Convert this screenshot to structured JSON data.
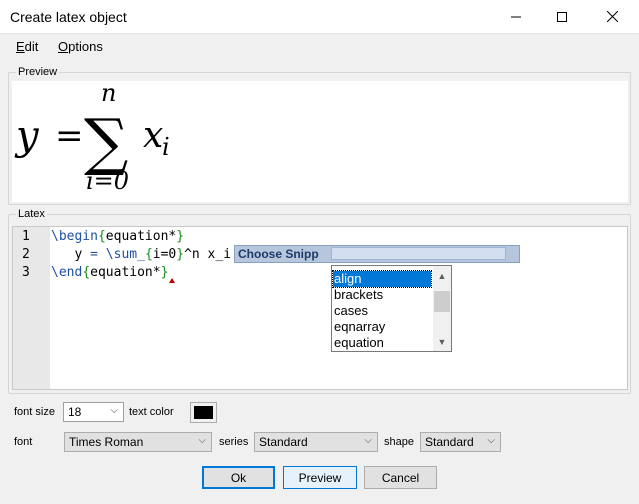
{
  "window": {
    "title": "Create latex object"
  },
  "menu": {
    "edit": "Edit",
    "options": "Options"
  },
  "preview": {
    "legend": "Preview",
    "formula": {
      "lhs": "y",
      "eq": "=",
      "sigma": "∑",
      "upper": "n",
      "lower": "i=0",
      "var": "x",
      "sub": "i"
    }
  },
  "latex": {
    "legend": "Latex",
    "line_numbers": [
      "1",
      "2",
      "3"
    ],
    "line1": {
      "cmd": "\\begin",
      "open": "{",
      "arg": "equation*",
      "close": "}"
    },
    "line2": {
      "indent": "   ",
      "y": "y",
      "eq": " = ",
      "sum": "\\sum_",
      "open": "{",
      "idx": "i=0",
      "close": "}",
      "rest": "^n x_i"
    },
    "line3": {
      "cmd": "\\end",
      "open": "{",
      "arg": "equation*",
      "close": "}"
    },
    "snippet": {
      "label": "Choose Snipp",
      "input_value": "",
      "options": [
        "align",
        "brackets",
        "cases",
        "eqnarray",
        "equation"
      ],
      "selected": "align"
    }
  },
  "controls": {
    "font_size_label": "font size",
    "font_size_value": "18",
    "text_color_label": "text color",
    "text_color": "#000000",
    "font_label": "font",
    "font_value": "Times Roman",
    "series_label": "series",
    "series_value": "Standard",
    "shape_label": "shape",
    "shape_value": "Standard"
  },
  "buttons": {
    "ok": "Ok",
    "preview": "Preview",
    "cancel": "Cancel"
  },
  "icons": {
    "minimize": "minimize-icon",
    "maximize": "maximize-icon",
    "close": "close-icon",
    "dropdown": "chevron-down-icon",
    "error": "error-marker-icon"
  }
}
